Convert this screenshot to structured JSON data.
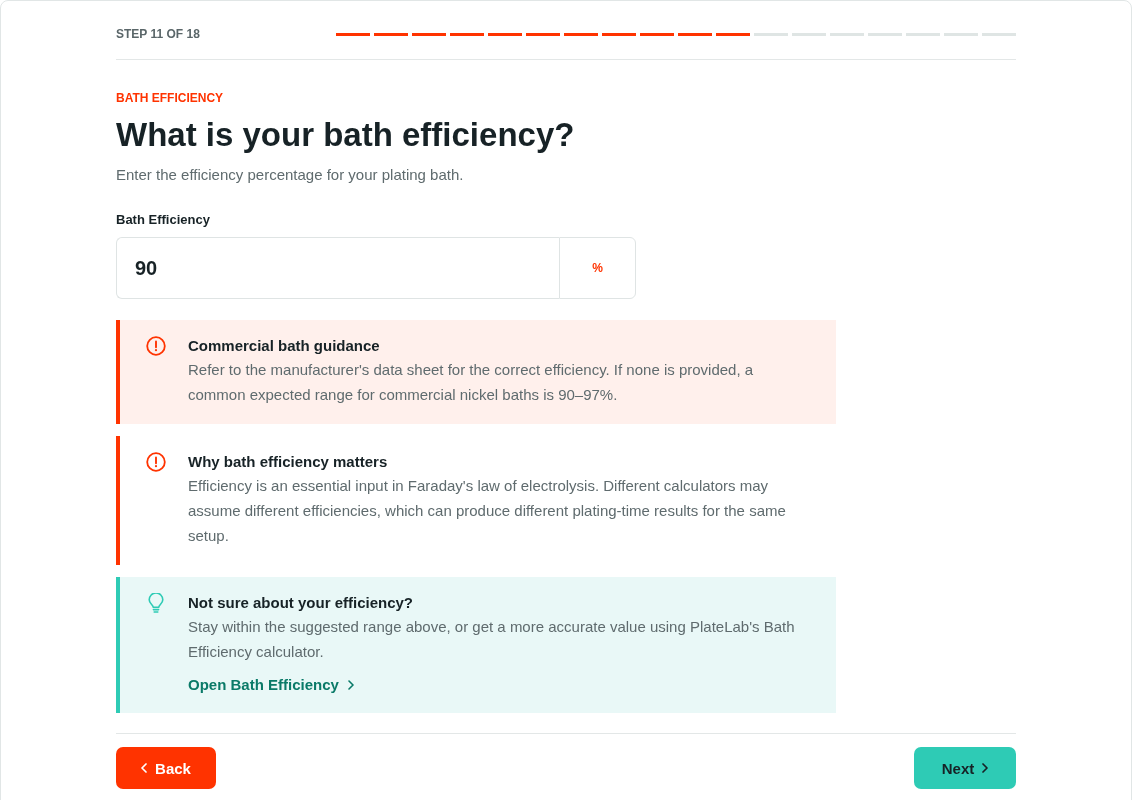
{
  "progress": {
    "label": "STEP 11 OF 18",
    "segments": [
      {
        "complete": true
      },
      {
        "complete": true
      },
      {
        "complete": true
      },
      {
        "complete": true
      },
      {
        "complete": true
      },
      {
        "complete": true
      },
      {
        "complete": true
      },
      {
        "complete": true
      },
      {
        "complete": true
      },
      {
        "complete": true
      },
      {
        "complete": true
      },
      {
        "complete": false
      },
      {
        "complete": false
      },
      {
        "complete": false
      },
      {
        "complete": false
      },
      {
        "complete": false
      },
      {
        "complete": false
      },
      {
        "complete": false
      }
    ]
  },
  "question": {
    "eyebrow": "BATH EFFICIENCY",
    "title": "What is your bath efficiency?",
    "subtitle": "Enter the efficiency percentage for your plating bath."
  },
  "field": {
    "label": "Bath Efficiency",
    "value": "90",
    "unit": "%"
  },
  "callouts": [
    {
      "kind": "alert",
      "filled": true,
      "title": "Commercial bath guidance",
      "body": "Refer to the manufacturer's data sheet for the correct efficiency. If none is provided, a common expected range for commercial nickel baths is 90–97%."
    },
    {
      "kind": "alert",
      "filled": false,
      "title": "Why bath efficiency matters",
      "body": "Efficiency is an essential input in Faraday's law of electrolysis. Different calculators may assume different efficiencies, which can produce different plating-time results for the same setup."
    },
    {
      "kind": "tip",
      "filled": true,
      "title": "Not sure about your efficiency?",
      "body": "Stay within the suggested range above, or get a more accurate value using PlateLab's Bath Efficiency calculator.",
      "link": "Open Bath Efficiency"
    }
  ],
  "footer": {
    "back": "Back",
    "next": "Next"
  }
}
